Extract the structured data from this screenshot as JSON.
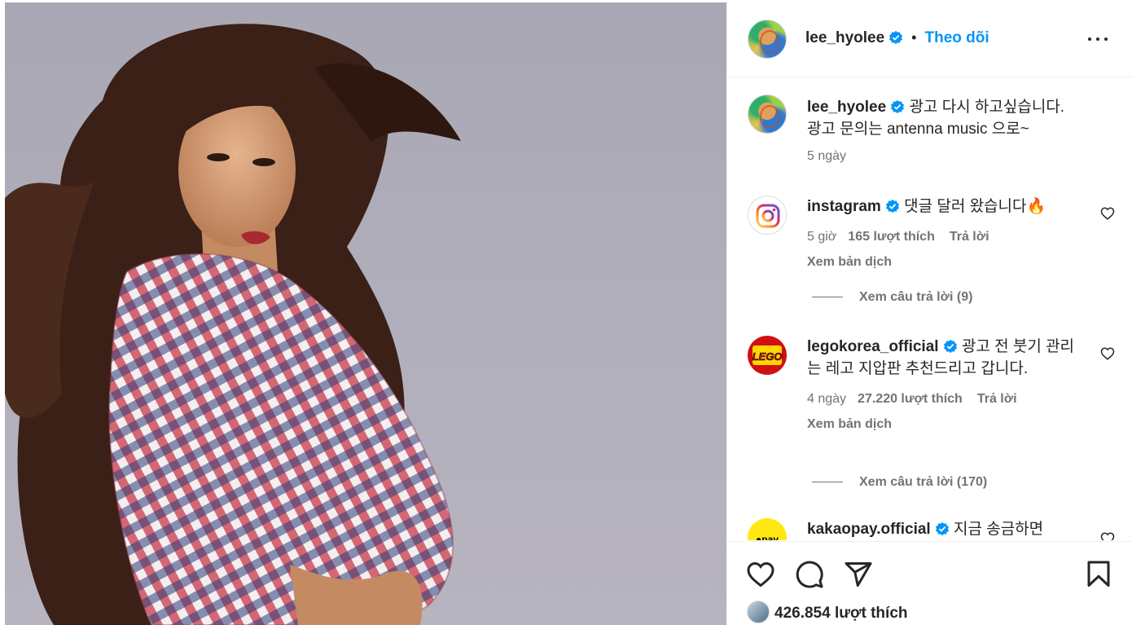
{
  "post": {
    "author": "lee_hyolee",
    "follow_label": "Theo dõi",
    "separator": "•",
    "caption_line1": "광고 다시 하고싶습니다.",
    "caption_line2": "광고 문의는 antenna music 으로~",
    "caption_time": "5 ngày"
  },
  "comments": [
    {
      "username": "instagram",
      "text": "댓글 달러 왔습니다🔥",
      "time": "5 giờ",
      "likes": "165 lượt thích",
      "reply_label": "Trả lời",
      "translate_label": "Xem bản dịch",
      "view_replies": "Xem câu trả lời (9)"
    },
    {
      "username": "legokorea_official",
      "text": "광고 전 붓기 관리는 레고 지압판 추천드리고 갑니다.",
      "time": "4 ngày",
      "likes": "27.220 lượt thích",
      "reply_label": "Trả lời",
      "translate_label": "Xem bản dịch",
      "view_replies": "Xem câu trả lời (170)",
      "logo_text": "LEGO"
    },
    {
      "username": "kakaopay.official",
      "text": "지금 송금하면",
      "logo_text": "●pay"
    }
  ],
  "footer": {
    "likes_count": "426.854 lượt thích"
  },
  "icons": {
    "verified": "verified-badge-icon",
    "more": "more-horizontal-icon",
    "like": "heart-icon",
    "comment": "comment-bubble-icon",
    "share": "paper-plane-icon",
    "save": "bookmark-icon"
  },
  "colors": {
    "accent": "#0095f6",
    "muted": "#737373",
    "text": "#262626"
  }
}
